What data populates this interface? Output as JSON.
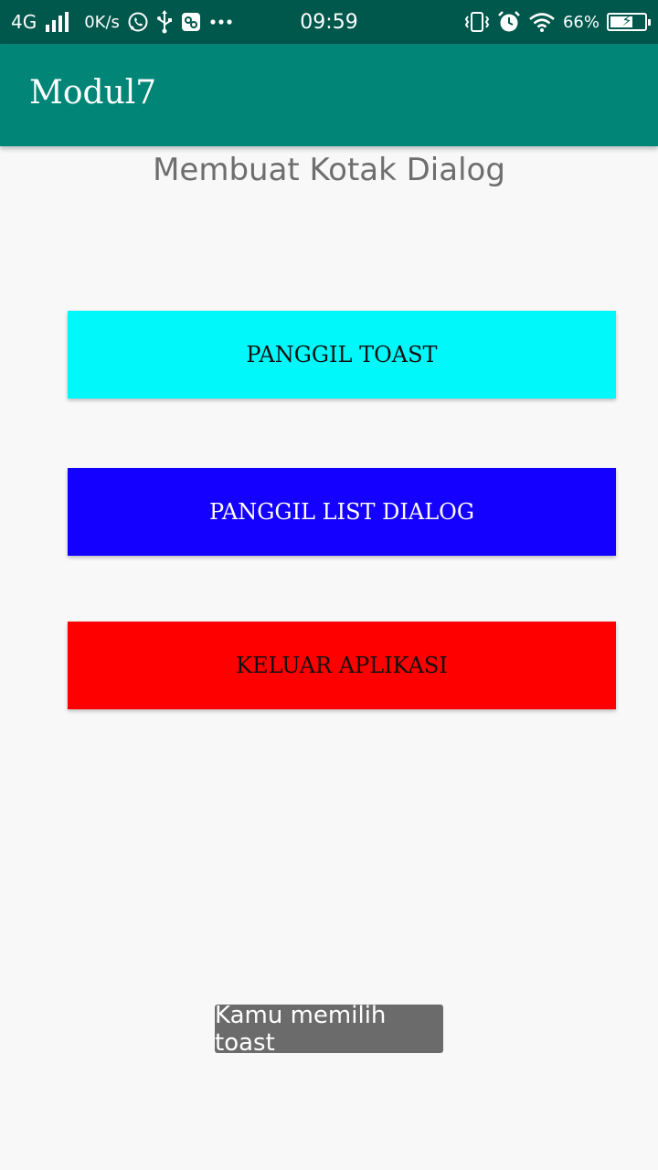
{
  "status_bar": {
    "network": "4G",
    "speed": "0K/s",
    "time": "09:59",
    "battery_percent": "66%",
    "battery_level": 0.66,
    "icons": [
      "signal-icon",
      "whatsapp-icon",
      "usb-icon",
      "settings-app-icon",
      "more-dots-icon",
      "vibrate-icon",
      "alarm-icon",
      "wifi-icon",
      "battery-charging-icon"
    ]
  },
  "app_bar": {
    "title": "Modul7"
  },
  "main": {
    "heading": "Membuat Kotak Dialog",
    "buttons": {
      "toast": "PANGGIL TOAST",
      "list_dialog": "PANGGIL LIST DIALOG",
      "exit": "KELUAR APLIKASI"
    }
  },
  "toast": {
    "message": "Kamu memilih toast"
  },
  "colors": {
    "status_bar": "#00574b",
    "app_bar": "#008577",
    "toast_button": "#00f8fa",
    "list_button": "#1400fe",
    "exit_button": "#fe0000",
    "toast_bg": "#6b6b6b"
  }
}
